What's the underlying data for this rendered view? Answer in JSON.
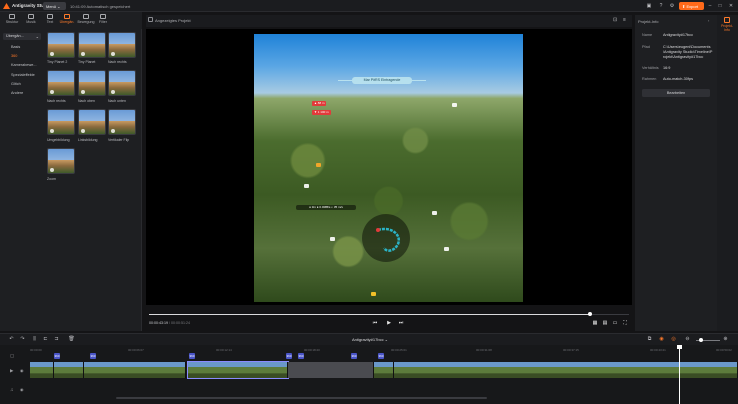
{
  "titlebar": {
    "app_name": "Antigravity Studio",
    "menu_label": "Menü",
    "autosave": "10:41:09 Automatisch gespeichert",
    "export_label": "Export"
  },
  "left_tabs": [
    {
      "label": "Struktur",
      "icon": "struktur-icon"
    },
    {
      "label": "Musik",
      "icon": "music-icon"
    },
    {
      "label": "Text",
      "icon": "text-icon"
    },
    {
      "label": "Übergän.",
      "icon": "transition-icon",
      "active": true
    },
    {
      "label": "Bewegung",
      "icon": "motion-icon"
    },
    {
      "label": "Filter",
      "icon": "filter-icon"
    }
  ],
  "category_select": "Übergän...",
  "categories": [
    {
      "label": "Basis"
    },
    {
      "label": "360",
      "active": true
    },
    {
      "label": "Kamerabewe..."
    },
    {
      "label": "Spezialeffekte"
    },
    {
      "label": "Glitch"
    },
    {
      "label": "Andere"
    }
  ],
  "transitions": [
    {
      "label": "Tiny Planet 2"
    },
    {
      "label": "Tiny Planet"
    },
    {
      "label": "Nach rechts"
    },
    {
      "label": "Nach rechts"
    },
    {
      "label": "Nach oben"
    },
    {
      "label": "Nach unten"
    },
    {
      "label": "Umgebbildung"
    },
    {
      "label": "Linksbildung"
    },
    {
      "label": "Vertikaler Flip"
    },
    {
      "label": "Zoom"
    }
  ],
  "preview": {
    "title": "Angezeigtes Projekt",
    "banner_text": "Mar PitRS Eintragende",
    "tag_1": "▲ 88 m",
    "tag_2": "▼ 1 100 m",
    "hint": "● 3m  ● 0.0MB/s  ◐ 35 m/s",
    "timecode_current": "00:00:43:19",
    "timecode_total": "/ 00:00:51:24"
  },
  "right_panel": {
    "title": "Projekt-Info",
    "props": [
      {
        "label": "Name",
        "value": "Antigravity#17bcc"
      },
      {
        "label": "Pfad",
        "value": "C:\\Users\\eugeni\\Documents\\Antigravity Studio\\Timeline\\Projekt\\Antigravity#17bcc"
      },
      {
        "label": "Verhältnis",
        "value": "16:9"
      },
      {
        "label": "Rahmen",
        "value": "Auto-match-30fps"
      }
    ],
    "edit_label": "Bearbeiten",
    "tab_label": "Projekt-Info"
  },
  "timeline": {
    "sequence_name": "Antigravity#17bcc ⌄",
    "ruler_ticks": [
      "00:00:00",
      "00:00:06:07",
      "00:00:12:14",
      "00:00:18:20",
      "00:00:25:01",
      "00:00:31:08",
      "00:00:37:15",
      "00:00:43:21",
      "00:00:50:02"
    ],
    "markers": [
      "360",
      "360",
      "360",
      "360",
      "360",
      "360",
      "360"
    ]
  },
  "colors": {
    "accent": "#ff6a1a",
    "marker": "#4a55c8",
    "background": "#141416"
  }
}
